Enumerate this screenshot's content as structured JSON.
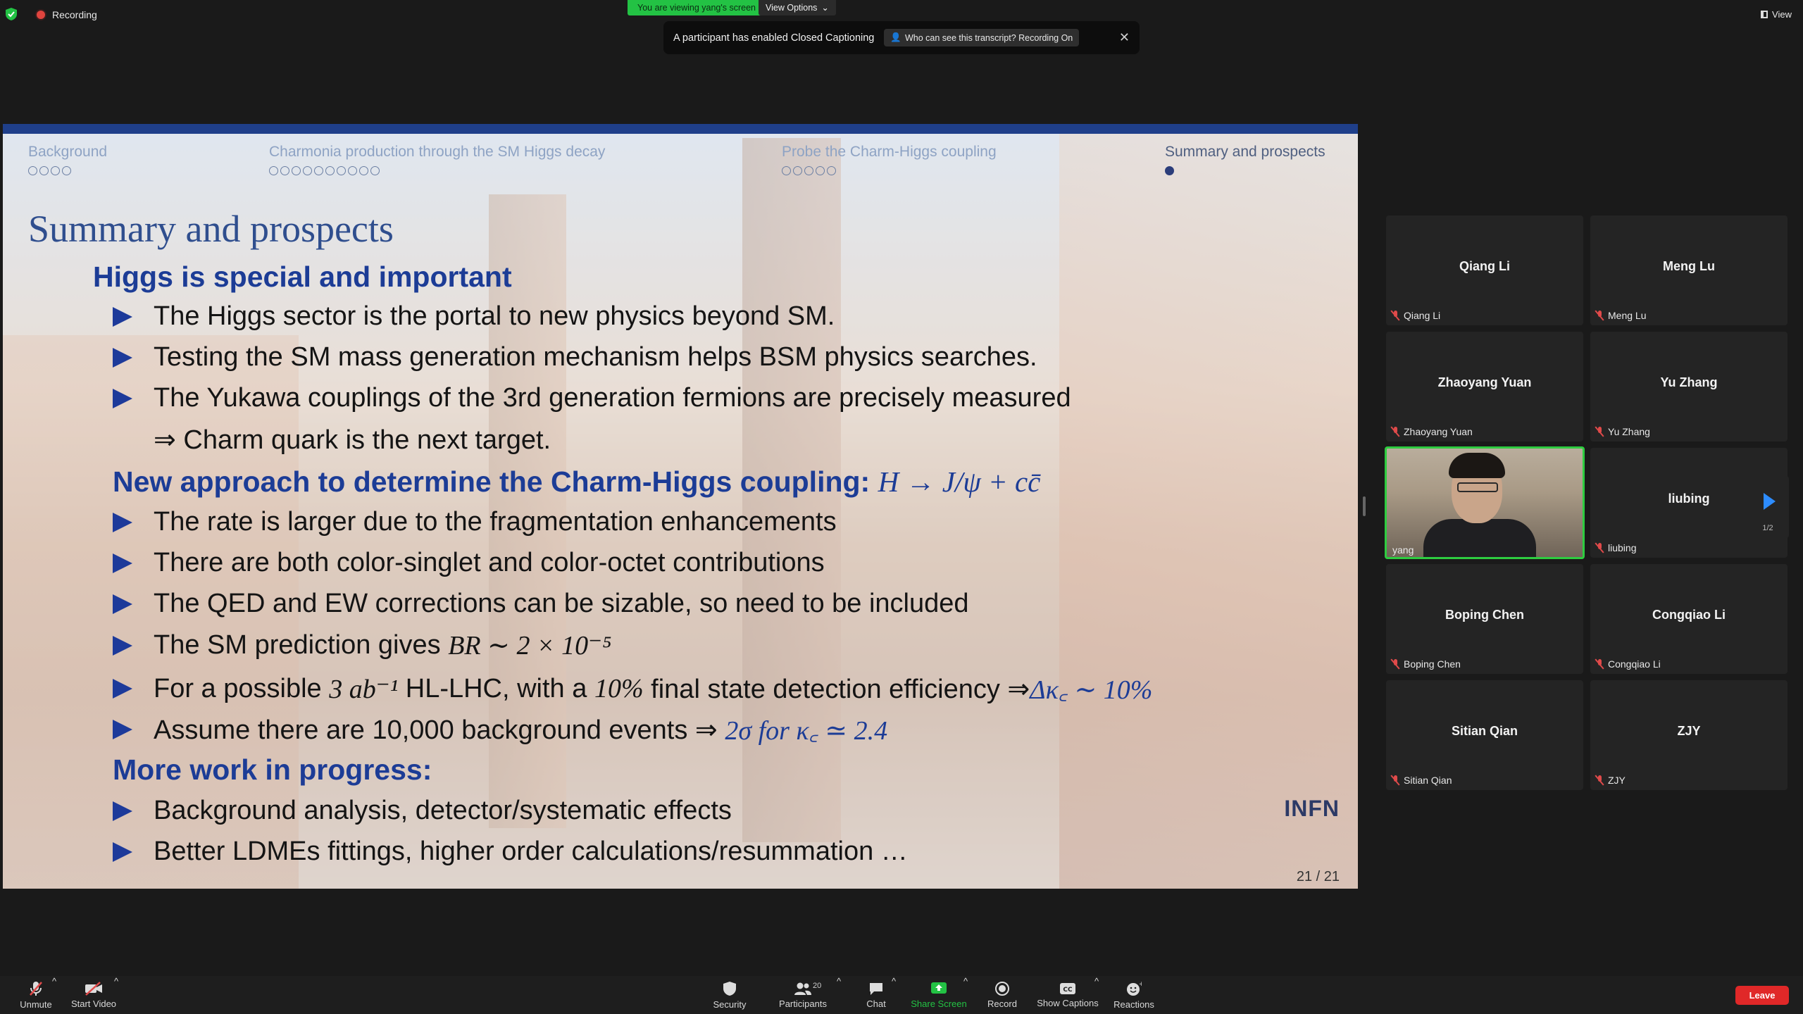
{
  "topbar": {
    "recording": "Recording",
    "viewing_banner": "You are viewing yang's screen",
    "view_options": "View Options",
    "view_button": "View"
  },
  "toast": {
    "message": "A participant has enabled Closed Captioning",
    "link": "Who can see this transcript? Recording On"
  },
  "slide": {
    "nav": [
      {
        "label": "Background",
        "dots": 4,
        "filled": 0
      },
      {
        "label": "Charmonia production through the SM Higgs decay",
        "dots": 10,
        "filled": 0
      },
      {
        "label": "Probe the Charm-Higgs coupling",
        "dots": 5,
        "filled": 0
      },
      {
        "label": "Summary and prospects",
        "dots": 1,
        "filled": 1
      }
    ],
    "title": "Summary and prospects",
    "head1": "Higgs is special and important",
    "b1": "The Higgs sector is the portal to new physics beyond SM.",
    "b2": "Testing the SM mass generation mechanism helps BSM physics searches.",
    "b3": "The Yukawa couplings of the 3rd generation fermions are precisely measured",
    "b3_cont": "⇒ Charm quark is the next target.",
    "head2": "New approach to determine the Charm-Higgs coupling:",
    "head2_math": "H → J/ψ + cc̄",
    "b4": "The rate is larger due to the fragmentation enhancements",
    "b5": "There are both color-singlet and color-octet contributions",
    "b6": "The QED and EW corrections can be sizable, so need to be included",
    "b7_text": "The SM prediction gives",
    "b7_math": "BR ∼ 2 × 10⁻⁵",
    "b8_text1": "For a possible",
    "b8_math1": "3 ab⁻¹",
    "b8_text2": "HL-LHC, with a",
    "b8_math2": "10%",
    "b8_text3": "final state detection efficiency ⇒",
    "b8_math3": "Δκ꜀ ∼ 10%",
    "b9_text": "Assume there are 10,000 background events ⇒",
    "b9_math": "2σ for κ꜀ ≃ 2.4",
    "head3": "More work in progress:",
    "b10": "Background analysis, detector/systematic effects",
    "b11": "Better LDMEs fittings, higher order calculations/resummation …",
    "logo": "INFN",
    "page": "21 / 21"
  },
  "participants": [
    {
      "name": "Qiang Li",
      "label": "Qiang Li"
    },
    {
      "name": "Meng Lu",
      "label": "Meng Lu"
    },
    {
      "name": "Zhaoyang Yuan",
      "label": "Zhaoyang Yuan"
    },
    {
      "name": "Yu Zhang",
      "label": "Yu Zhang"
    },
    {
      "name": "",
      "label": "yang"
    },
    {
      "name": "liubing",
      "label": "liubing"
    },
    {
      "name": "Boping Chen",
      "label": "Boping Chen"
    },
    {
      "name": "Congqiao Li",
      "label": "Congqiao Li"
    },
    {
      "name": "Sitian Qian",
      "label": "Sitian Qian"
    },
    {
      "name": "ZJY",
      "label": "ZJY"
    }
  ],
  "pager": "1/2",
  "toolbar": {
    "unmute": "Unmute",
    "start_video": "Start Video",
    "security": "Security",
    "participants": "Participants",
    "participants_count": "20",
    "chat": "Chat",
    "share_screen": "Share Screen",
    "record": "Record",
    "show_captions": "Show Captions",
    "reactions": "Reactions",
    "leave": "Leave"
  },
  "colors": {
    "accent_green": "#23c244",
    "share_green": "#23c244",
    "leave_red": "#e02828",
    "slide_blue": "#1c3c96"
  }
}
